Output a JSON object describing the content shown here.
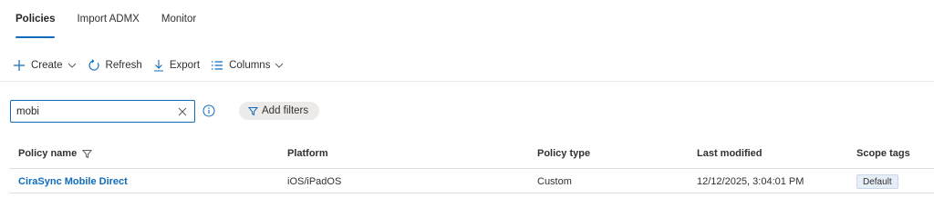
{
  "tabs": [
    {
      "label": "Policies",
      "active": true
    },
    {
      "label": "Import ADMX",
      "active": false
    },
    {
      "label": "Monitor",
      "active": false
    }
  ],
  "toolbar": {
    "create_label": "Create",
    "refresh_label": "Refresh",
    "export_label": "Export",
    "columns_label": "Columns"
  },
  "search": {
    "value": "mobi",
    "placeholder": ""
  },
  "filters": {
    "add_filters_label": "Add filters"
  },
  "table": {
    "columns": [
      "Policy name",
      "Platform",
      "Policy type",
      "Last modified",
      "Scope tags"
    ],
    "rows": [
      {
        "policy_name": "CiraSync Mobile Direct",
        "platform": "iOS/iPadOS",
        "policy_type": "Custom",
        "last_modified": "12/12/2025, 3:04:01 PM",
        "scope_tags": "Default"
      }
    ]
  },
  "colors": {
    "accent": "#0f6cbd",
    "text": "#323130",
    "divider": "#e1dfdd",
    "pill_bg": "#edebe9",
    "badge_bg": "#e6eef6"
  }
}
